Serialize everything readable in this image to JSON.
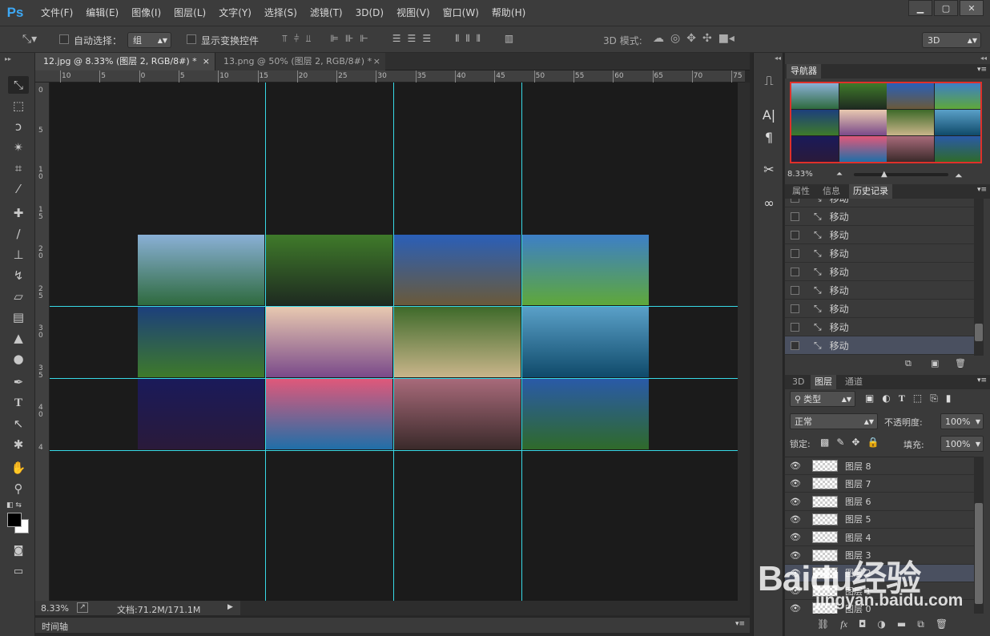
{
  "app": {
    "logo": "Ps"
  },
  "menu": [
    "文件(F)",
    "编辑(E)",
    "图像(I)",
    "图层(L)",
    "文字(Y)",
    "选择(S)",
    "滤镜(T)",
    "3D(D)",
    "视图(V)",
    "窗口(W)",
    "帮助(H)"
  ],
  "options": {
    "auto_select_label": "自动选择：",
    "auto_select_value": "组",
    "show_transform_label": "显示变换控件",
    "mode_3d_label": "3D 模式:",
    "workspace_value": "3D"
  },
  "tabs": [
    {
      "label": "12.jpg @ 8.33% (图层 2, RGB/8#) *",
      "close": "×"
    },
    {
      "label": "13.png @ 50% (图层 2, RGB/8#) *",
      "close": "×"
    }
  ],
  "ruler": {
    "h_ticks": [
      "10",
      "5",
      "0",
      "5",
      "10",
      "15",
      "20",
      "25",
      "30",
      "35",
      "40",
      "45",
      "50",
      "55",
      "60",
      "65",
      "70",
      "75"
    ],
    "v_ticks": [
      "0",
      "5",
      "1\n0",
      "1\n5",
      "2\n0",
      "2\n5",
      "3\n0",
      "3\n5",
      "4\n0",
      "4"
    ]
  },
  "status": {
    "zoom": "8.33%",
    "doc_info": "文档:71.2M/171.1M"
  },
  "timeline_label": "时间轴",
  "navigator": {
    "title": "导航器",
    "zoom": "8.33%"
  },
  "history_panel": {
    "tabs": [
      "属性",
      "信息",
      "历史记录"
    ],
    "items": [
      "移动",
      "移动",
      "移动",
      "移动",
      "移动",
      "移动",
      "移动",
      "移动",
      "移动"
    ]
  },
  "layers_panel": {
    "tabs": [
      "3D",
      "图层",
      "通道"
    ],
    "filter_kind": "类型",
    "blend_mode": "正常",
    "opacity_label": "不透明度:",
    "opacity_value": "100%",
    "lock_label": "锁定:",
    "fill_label": "填充:",
    "fill_value": "100%",
    "layers": [
      "图层 8",
      "图层 7",
      "图层 6",
      "图层 5",
      "图层 4",
      "图层 3",
      "图层 2",
      "图层 1",
      "图层 0"
    ],
    "footer_icons": [
      "link-icon",
      "fx-icon",
      "mask-icon",
      "adjustment-icon",
      "folder-icon",
      "new-layer-icon",
      "trash-icon"
    ]
  },
  "watermark": {
    "text": "Baidu经验",
    "url": "jingyan.baidu.com"
  },
  "canvas_tiles": [
    {
      "name": "lake-mountains",
      "top": "#8ab0d6",
      "bottom": "#2e6a3e"
    },
    {
      "name": "waterfall-forest",
      "top": "#3f7a2a",
      "bottom": "#1e2a20"
    },
    {
      "name": "sunburst-river",
      "top": "#2a5fb8",
      "bottom": "#6a5a3a"
    },
    {
      "name": "green-hills",
      "top": "#3d7fc7",
      "bottom": "#5fa83a"
    },
    {
      "name": "fjord-ship",
      "top": "#1c3f7c",
      "bottom": "#3e7a2a"
    },
    {
      "name": "lavender-tree",
      "top": "#e8c9b0",
      "bottom": "#7a4a8a"
    },
    {
      "name": "puppy",
      "top": "#3e6a2a",
      "bottom": "#c9b58a"
    },
    {
      "name": "mountain-lake",
      "top": "#5aa0c8",
      "bottom": "#0f4a6a"
    },
    {
      "name": "night-tree",
      "top": "#1a1a5a",
      "bottom": "#2a1a3a"
    },
    {
      "name": "sunset-pier",
      "top": "#e0587a",
      "bottom": "#1f6fa8"
    },
    {
      "name": "misty-trees",
      "top": "#a86a7a",
      "bottom": "#3a2a2a"
    },
    {
      "name": "rocky-coast",
      "top": "#2a5aa8",
      "bottom": "#2f6a2a"
    }
  ]
}
